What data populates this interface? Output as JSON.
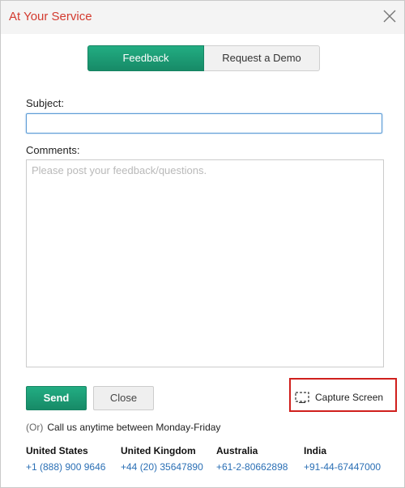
{
  "dialog": {
    "title": "At Your Service"
  },
  "tabs": [
    {
      "label": "Feedback",
      "active": true
    },
    {
      "label": "Request a Demo",
      "active": false
    }
  ],
  "form": {
    "subject_label": "Subject:",
    "subject_value": "",
    "comments_label": "Comments:",
    "comments_placeholder": "Please post your feedback/questions."
  },
  "actions": {
    "send_label": "Send",
    "close_label": "Close",
    "capture_label": "Capture Screen"
  },
  "contact": {
    "or_label": "(Or)",
    "call_text": "Call us anytime between Monday-Friday",
    "countries": [
      {
        "name": "United States",
        "phone": "+1 (888) 900 9646"
      },
      {
        "name": "United Kingdom",
        "phone": "+44 (20) 35647890"
      },
      {
        "name": "Australia",
        "phone": "+61-2-80662898"
      },
      {
        "name": "India",
        "phone": "+91-44-67447000"
      }
    ]
  },
  "colors": {
    "accent_green": "#1c9a74",
    "title_red": "#d33a2f",
    "link_blue": "#2a6fb5",
    "highlight_red": "#d0201d"
  },
  "icons": {
    "close": "close-icon",
    "capture": "screen-capture-icon"
  }
}
